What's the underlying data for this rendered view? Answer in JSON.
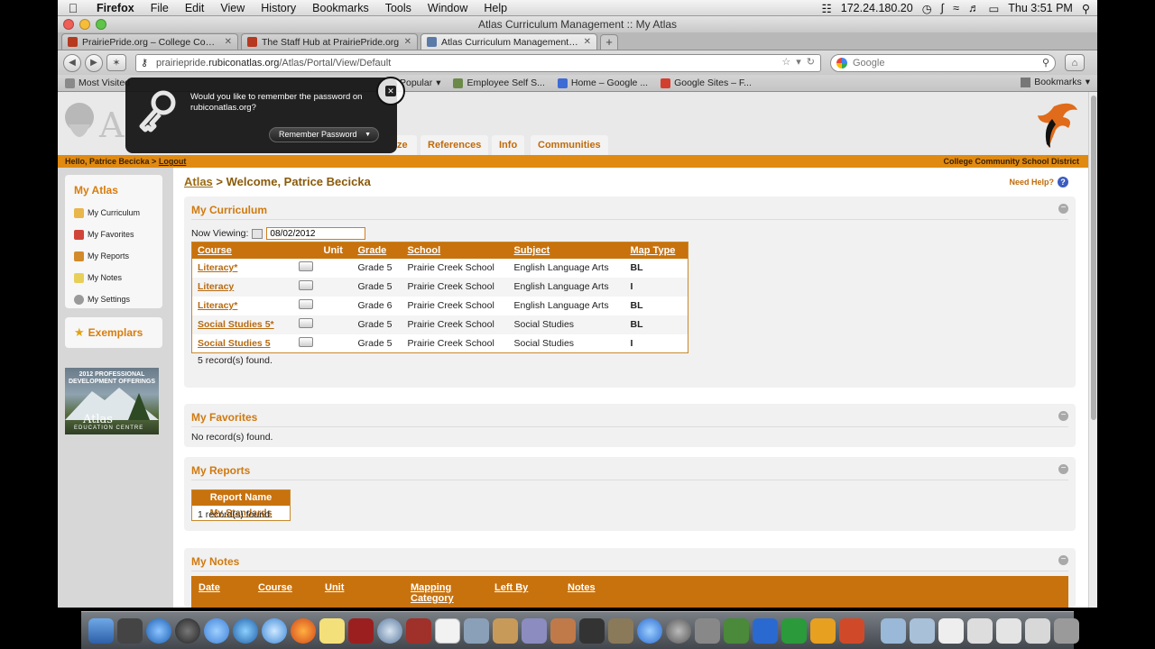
{
  "menubar": {
    "app": "Firefox",
    "items": [
      "File",
      "Edit",
      "View",
      "History",
      "Bookmarks",
      "Tools",
      "Window",
      "Help"
    ],
    "ip": "172.24.180.20",
    "clock": "Thu 3:51 PM"
  },
  "window": {
    "title": "Atlas Curriculum Management :: My Atlas"
  },
  "tabs": [
    {
      "label": "PrairiePride.org – College Com..."
    },
    {
      "label": "The Staff Hub at PrairiePride.org"
    },
    {
      "label": "Atlas Curriculum Management ::..."
    }
  ],
  "url": {
    "prefix": "prairiepride.",
    "host": "rubiconatlas.org",
    "path": "/Atlas/Portal/View/Default"
  },
  "search": {
    "placeholder": "Google"
  },
  "bookmarks": {
    "items": [
      "Most Visited",
      "Popular",
      "Employee Self S...",
      "Home – Google ...",
      "Google Sites – F..."
    ],
    "right": "Bookmarks"
  },
  "header": {
    "tabs": [
      "ze",
      "References",
      "Info",
      "Communities"
    ]
  },
  "userbar": {
    "greeting": "Hello, Patrice Becicka >",
    "logout": "Logout",
    "district": "College Community School District"
  },
  "sidebar": {
    "title": "My Atlas",
    "items": [
      "My Curriculum",
      "My Favorites",
      "My Reports",
      "My Notes",
      "My Settings"
    ],
    "exemplars": "Exemplars",
    "promo": {
      "line1": "2012 PROFESSIONAL",
      "line2": "DEVELOPMENT OFFERINGS",
      "brand": "Atlas",
      "sub": "EDUCATION CENTRE"
    }
  },
  "main": {
    "crumb_link": "Atlas",
    "crumb_rest": " > Welcome, Patrice Becicka",
    "need_help": "Need Help?"
  },
  "curriculum": {
    "title": "My Curriculum",
    "viewing_label": "Now Viewing:",
    "date": "08/02/2012",
    "columns": [
      "Course",
      "Unit",
      "Grade",
      "School",
      "Subject",
      "Map Type"
    ],
    "rows": [
      {
        "course": "Literacy*",
        "grade": "Grade 5",
        "school": "Prairie Creek School",
        "subject": "English Language Arts",
        "type": "BL"
      },
      {
        "course": "Literacy",
        "grade": "Grade 5",
        "school": "Prairie Creek School",
        "subject": "English Language Arts",
        "type": "I"
      },
      {
        "course": "Literacy*",
        "grade": "Grade 6",
        "school": "Prairie Creek School",
        "subject": "English Language Arts",
        "type": "BL"
      },
      {
        "course": "Social Studies 5*",
        "grade": "Grade 5",
        "school": "Prairie Creek School",
        "subject": "Social Studies",
        "type": "BL"
      },
      {
        "course": "Social Studies 5",
        "grade": "Grade 5",
        "school": "Prairie Creek School",
        "subject": "Social Studies",
        "type": "I"
      }
    ],
    "count": "5 record(s) found."
  },
  "favorites": {
    "title": "My Favorites",
    "empty": "No record(s) found."
  },
  "reports": {
    "title": "My Reports",
    "column": "Report Name",
    "item": "My Standards",
    "count": "1 record(s) found."
  },
  "notes": {
    "title": "My Notes",
    "columns": [
      "Date",
      "Course",
      "Unit",
      "Mapping\nCategory",
      "Left By",
      "Notes"
    ]
  },
  "password_popup": {
    "message": "Would you like to remember the password on rubiconatlas.org?",
    "button": "Remember Password"
  },
  "colors": {
    "accent": "#d07a10",
    "header_bar": "#e08a12",
    "table_head": "#c8720e"
  }
}
